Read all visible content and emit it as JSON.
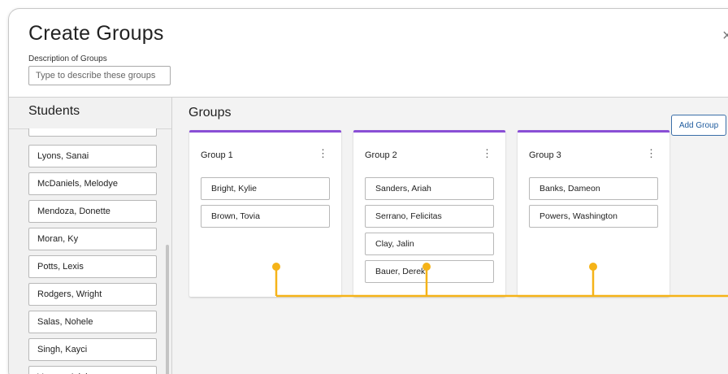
{
  "dialog": {
    "title": "Create Groups",
    "close_glyph": "×",
    "description_label": "Description of Groups",
    "description_placeholder": "Type to describe these groups",
    "description_value": ""
  },
  "students": {
    "heading": "Students",
    "items": [
      "",
      "Lyons, Sanai",
      "McDaniels, Melodye",
      "Mendoza, Donette",
      "Moran, Ky",
      "Potts, Lexis",
      "Rodgers, Wright",
      "Salas, Nohele",
      "Singh, Kayci",
      "Vargas, Adalene"
    ]
  },
  "groups": {
    "heading": "Groups",
    "add_label": "Add Group",
    "menu_glyph": "⋮",
    "list": [
      {
        "name": "Group 1",
        "members": [
          "Bright, Kylie",
          "Brown, Tovia"
        ]
      },
      {
        "name": "Group 2",
        "members": [
          "Sanders, Ariah",
          "Serrano, Felicitas",
          "Clay, Jalin",
          "Bauer, Derek"
        ]
      },
      {
        "name": "Group 3",
        "members": [
          "Banks, Dameon",
          "Powers, Washington"
        ]
      }
    ]
  },
  "colors": {
    "group_accent": "#8a4fd6",
    "callout": "#f5b318",
    "button_text": "#1e5b9e"
  }
}
